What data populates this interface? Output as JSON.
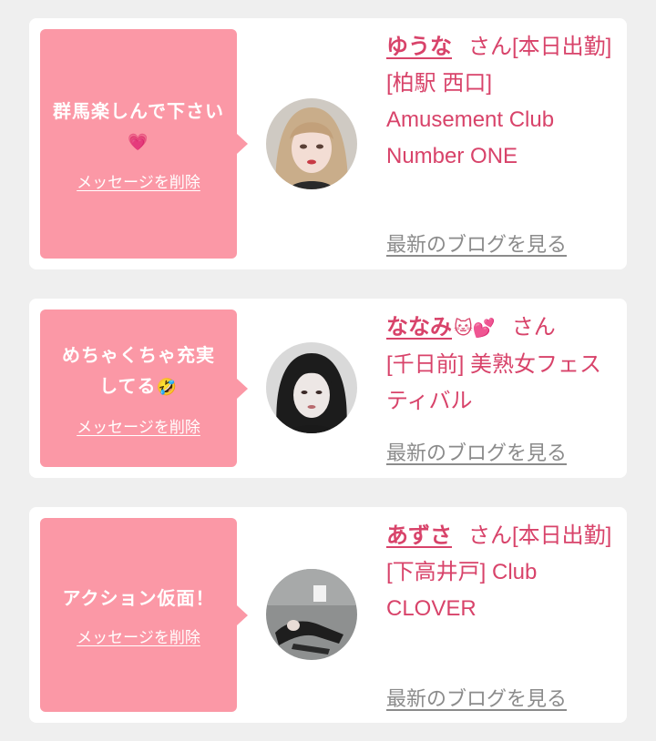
{
  "messages": [
    {
      "message": "群馬楽しんで下さい",
      "message_emoji": "💗",
      "delete_label": "メッセージを削除",
      "name": "ゆうな",
      "suffix": "さん[本日出勤]",
      "shop": "[柏駅 西口] Amusement Club Number ONE",
      "blog_label": "最新のブログを見る",
      "avatar_icon": "avatar-photo-icon"
    },
    {
      "message": "めちゃくちゃ充実してる",
      "message_emoji": "🤣",
      "delete_label": "メッセージを削除",
      "name": "ななみ",
      "name_emoji": "🐱💕",
      "suffix": "さん",
      "shop": "[千日前] 美熟女フェスティバル",
      "blog_label": "最新のブログを見る",
      "avatar_icon": "avatar-photo-icon"
    },
    {
      "message": "アクション仮面！",
      "message_emoji": "",
      "delete_label": "メッセージを削除",
      "name": "あずさ",
      "suffix": "さん[本日出勤]",
      "shop": "[下高井戸] Club CLOVER",
      "blog_label": "最新のブログを見る",
      "avatar_icon": "avatar-photo-icon"
    }
  ],
  "colors": {
    "bubble": "#fb98a6",
    "accent_text": "#d8436a",
    "link_gray": "#8b8b8b",
    "background": "#efefef"
  }
}
